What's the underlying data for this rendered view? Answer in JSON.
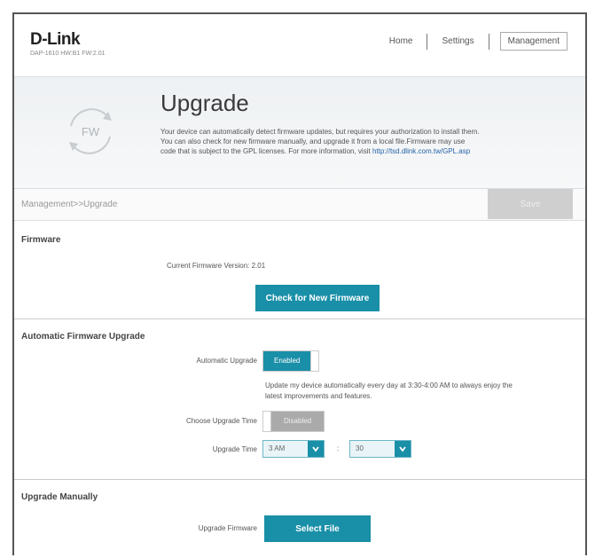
{
  "header": {
    "logo": "D-Link",
    "model": "DAP-1610 HW:B1 FW:2.01",
    "nav": [
      "Home",
      "Settings",
      "Management"
    ]
  },
  "banner": {
    "badge": "FW",
    "title": "Upgrade",
    "desc_line1": "Your device can automatically detect firmware updates, but requires your authorization to install them.",
    "desc_line2": "You can also check for new firmware manually, and upgrade it from a local file.Firmware may use",
    "desc_line3": "code that is subject to the GPL licenses. For more information, visit",
    "gpl_link": "http://tsd.dlink.com.tw/GPL.asp"
  },
  "breadcrumb": "Management>>Upgrade",
  "save_label": "Save",
  "firmware": {
    "title": "Firmware",
    "current_version": "Current Firmware Version: 2.01",
    "check_button": "Check for New Firmware"
  },
  "auto": {
    "title": "Automatic Firmware Upgrade",
    "auto_label": "Automatic Upgrade",
    "auto_state": "Enabled",
    "auto_note_1": "Update my device automatically every day at 3:30-4:00 AM to always enjoy the",
    "auto_note_2": "latest improvements and features.",
    "time_toggle_label": "Choose Upgrade Time",
    "time_toggle_state": "Disabled",
    "time_label": "Upgrade Time",
    "hour": "3 AM",
    "colon": ":",
    "minute": "30"
  },
  "manual": {
    "title": "Upgrade Manually",
    "label": "Upgrade Firmware",
    "select_button": "Select File"
  }
}
